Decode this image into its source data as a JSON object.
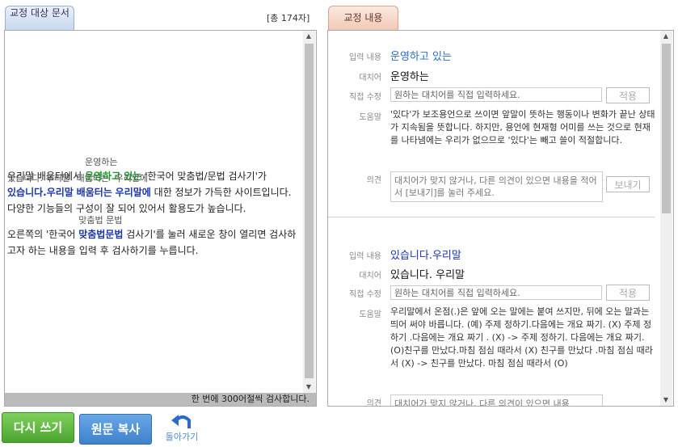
{
  "left_tab": {
    "label": "교정 대상 문서"
  },
  "right_tab": {
    "label": "교정 내용"
  },
  "char_count": "[총 174자]",
  "document": {
    "p1": {
      "t1": "우리말 배움터에서 ",
      "s1_hint": "운영하는",
      "s1_text": "운영하고 있는",
      "t2": " '한국어 맞춤법/문법 검사기'가 ",
      "s2_hint": "있습니다. 우리말",
      "s2_text": "있습니다.우리말",
      "t3": " ",
      "s3_hint": "배움터는",
      "s3_text": "배움터는",
      "t4": "  ",
      "s4_hint": "우리말에",
      "s4_text": "우리말에",
      "t5": " 대한 정보가 가득한 사이트입니다. 다양한 기능들의 구성이 잘 되어 있어서 활용도가 높습니다."
    },
    "p2": {
      "t1": "오른쪽의 '한국어 ",
      "s1_hint": "맞춤법 문법",
      "s1_text": "맞춤법문법",
      "t2": " 검사기'를 눌러 새로운 창이 열리면 검사하고자 하는 내용을 입력 후 검사하기를 누릅니다."
    }
  },
  "status_text": "한 번에 300어절씩 검사합니다.",
  "labels": {
    "input": "입력 내용",
    "replace": "대치어",
    "direct": "직접 수정",
    "help": "도움말",
    "opinion": "의견"
  },
  "corrections": [
    {
      "input": "운영하고 있는",
      "replace": "운영하는",
      "direct_placeholder": "원하는 대치어를 직접 입력하세요.",
      "apply_label": "적용",
      "help": "'있다'가 보조용언으로 쓰이면 앞말이 뜻하는 행동이나 변화가 끝난 상태가 지속됨을 뜻합니다. 하지만, 용언에 현재형 어미를 쓰는 것으로 현재를 나타냄에는 우리가 없으므로 '있다'는 빼고 쓸이 적절합니다.",
      "opinion_placeholder": "대치어가 맞지 않거나, 다른 의견이 있으면 내용을 적어서 [보내기]를 눌러 주세요.",
      "send_label": "보내기"
    },
    {
      "input": "있습니다.우리말",
      "replace": "있습니다. 우리말",
      "direct_placeholder": "원하는 대치어를 직접 입력하세요.",
      "apply_label": "적용",
      "help": "우리말에서 온점(.)은 앞에 오는 말에는 붙여 쓰지만, 뒤에 오는 말과는 띄어 써야 바릅니다. (예) 주제 정하기.다음에는 개요 짜기. (X) 주제 정하기 .다음에는 개요 짜기 . (X) -> 주제 정하기. 다음에는 개요 짜기. (O)친구를 만났다.마침 점심 때라서 (X) 친구를 만났다 .마침 점심 때라서 (X) -> 친구를 만났다. 마침 점심 때라서 (O)",
      "opinion_placeholder": "대치어가 맞지 않거나, 다른 의견이 있으면 내용"
    }
  ],
  "buttons": {
    "rewrite": "다시 쓰기",
    "copy_original": "원문 복사",
    "back": "돌아가기"
  },
  "colors": {
    "rewrite_bg": "#5cb83c",
    "copy_bg": "#4a90d9",
    "green_error": "#1a9a2a",
    "blue_error": "#1a35b0",
    "accent_link": "#2a6dc9"
  }
}
